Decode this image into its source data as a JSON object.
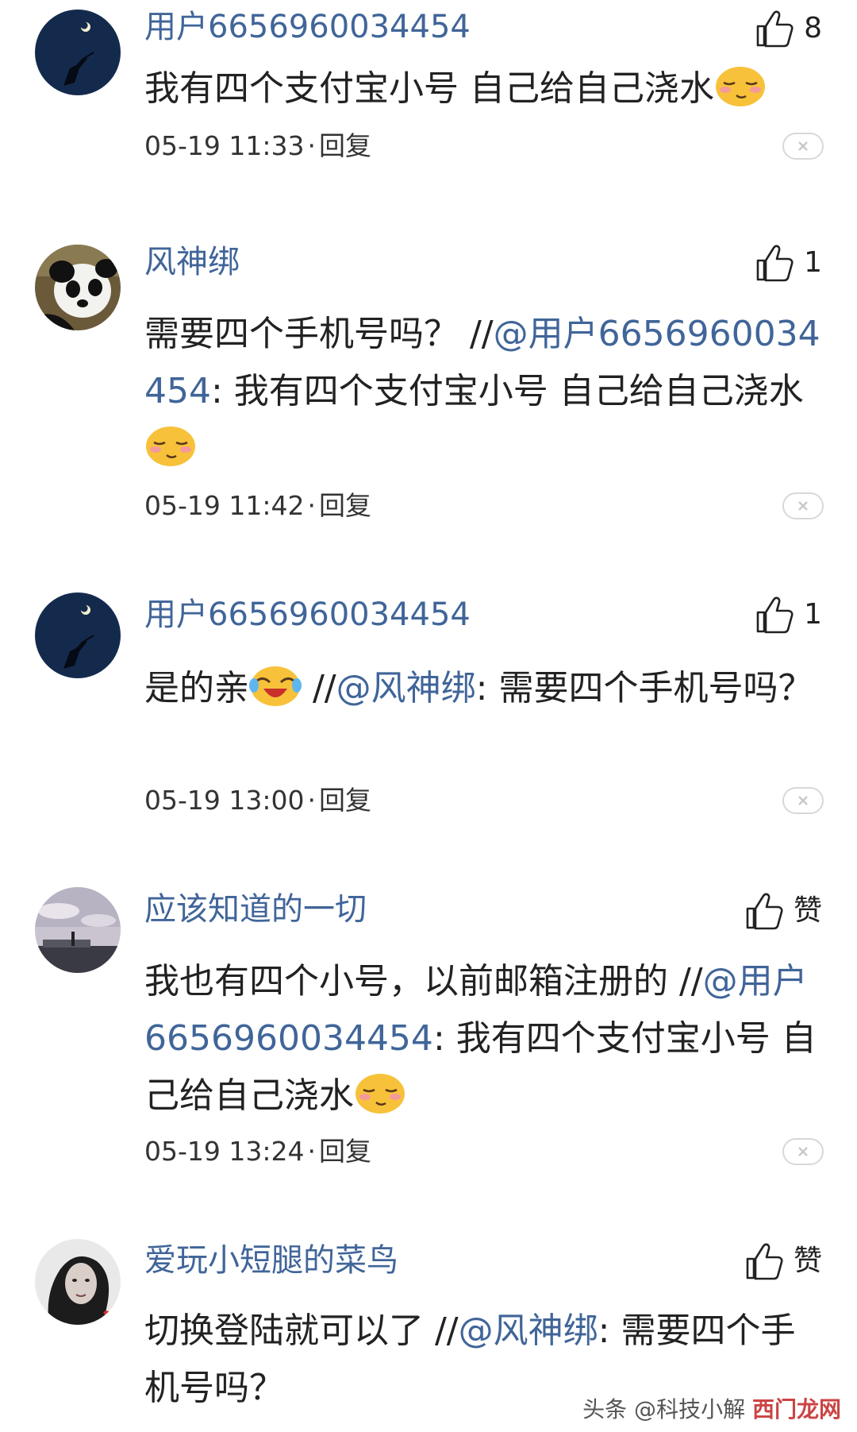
{
  "comments": [
    {
      "username": "用户6656960034454",
      "likes": "8",
      "text_main": "我有四个支付宝小号 自己给自己浇水",
      "emoji": "smirk-emoji",
      "time": "05-19 11:33",
      "separator": "·",
      "reply": "回复"
    },
    {
      "username": "风神绑",
      "likes": "1",
      "text_main": "需要四个手机号吗？ //",
      "mention": "@用户6656960034454",
      "text_quote": ": 我有四个支付宝小号 自己给自己浇水",
      "emoji": "smirk-emoji",
      "time": "05-19 11:42",
      "separator": "·",
      "reply": "回复"
    },
    {
      "username": "用户6656960034454",
      "likes": "1",
      "text_main": "是的亲",
      "emoji": "laugh-cry-emoji",
      "text_after_emoji": " //",
      "mention": "@风神绑",
      "text_quote": ": 需要四个手机号吗？",
      "time": "05-19 13:00",
      "separator": "·",
      "reply": "回复"
    },
    {
      "username": "应该知道的一切",
      "likes": "赞",
      "text_main": "我也有四个小号，以前邮箱注册的 //",
      "mention": "@用户6656960034454",
      "text_quote": ": 我有四个支付宝小号 自己给自己浇水",
      "emoji": "smirk-emoji",
      "time": "05-19 13:24",
      "separator": "·",
      "reply": "回复"
    },
    {
      "username": "爱玩小短腿的菜鸟",
      "likes": "赞",
      "text_main": "切换登陆就可以了 //",
      "mention": "@风神绑",
      "text_quote": ": 需要四个手机号吗？"
    }
  ],
  "watermark": {
    "prefix": "头条 @",
    "text": "科技小解",
    "brand": "西门龙网"
  },
  "colors": {
    "link": "#406599",
    "text": "#222222",
    "meta": "#333333"
  }
}
